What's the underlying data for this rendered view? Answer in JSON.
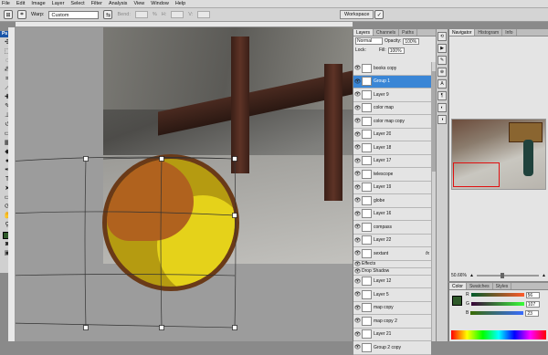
{
  "menu": [
    "File",
    "Edit",
    "Image",
    "Layer",
    "Select",
    "Filter",
    "Analysis",
    "View",
    "Window",
    "Help"
  ],
  "options": {
    "warp_label": "Warp:",
    "warp_value": "Custom",
    "bend_label": "Bend:",
    "bend_value": "0.0",
    "bend_unit": "%",
    "h_label": "H:",
    "h_value": "0.0",
    "v_label": "V:",
    "v_value": "0.0",
    "workspace": "Workspace"
  },
  "tools": {
    "app_badge": "Ps"
  },
  "layers_panel": {
    "tabs": [
      "Layers",
      "Channels",
      "Paths"
    ],
    "blend_mode": "Normal",
    "opacity_label": "Opacity:",
    "opacity_value": "100%",
    "fill_label": "Fill:",
    "fill_value": "100%",
    "lock_label": "Lock:",
    "layers": [
      {
        "name": "books copy",
        "selected": false
      },
      {
        "name": "Group 1",
        "selected": true
      },
      {
        "name": "Layer 9",
        "selected": false
      },
      {
        "name": "color map",
        "selected": false
      },
      {
        "name": "color map copy",
        "selected": false
      },
      {
        "name": "Layer 20",
        "selected": false
      },
      {
        "name": "Layer 18",
        "selected": false
      },
      {
        "name": "Layer 17",
        "selected": false
      },
      {
        "name": "telescope",
        "selected": false
      },
      {
        "name": "Layer 19",
        "selected": false
      },
      {
        "name": "globe",
        "selected": false
      },
      {
        "name": "Layer 16",
        "selected": false
      },
      {
        "name": "compass",
        "selected": false
      },
      {
        "name": "Layer 22",
        "selected": false
      },
      {
        "name": "sextant",
        "selected": false,
        "fx": "fx"
      }
    ],
    "effects_label": "Effects",
    "effect_item": "Drop Shadow",
    "layers_after": [
      {
        "name": "Layer 12"
      },
      {
        "name": "Layer 5"
      },
      {
        "name": "map copy"
      },
      {
        "name": "map copy 2"
      },
      {
        "name": "Layer 21"
      },
      {
        "name": "Group 2 copy"
      }
    ]
  },
  "navigator": {
    "tabs": [
      "Navigator",
      "Histogram",
      "Info"
    ],
    "zoom": "50.66%"
  },
  "color_panel": {
    "tabs": [
      "Color",
      "Swatches",
      "Styles"
    ],
    "channels": [
      {
        "label": "R",
        "value": "56",
        "track": "linear-gradient(90deg,#005a2a,#ff5a2a)"
      },
      {
        "label": "G",
        "value": "107",
        "track": "linear-gradient(90deg,#380038,#38ff38)"
      },
      {
        "label": "B",
        "value": "23",
        "track": "linear-gradient(90deg,#386b00,#386bff)"
      }
    ],
    "foreground": "#386b17"
  }
}
